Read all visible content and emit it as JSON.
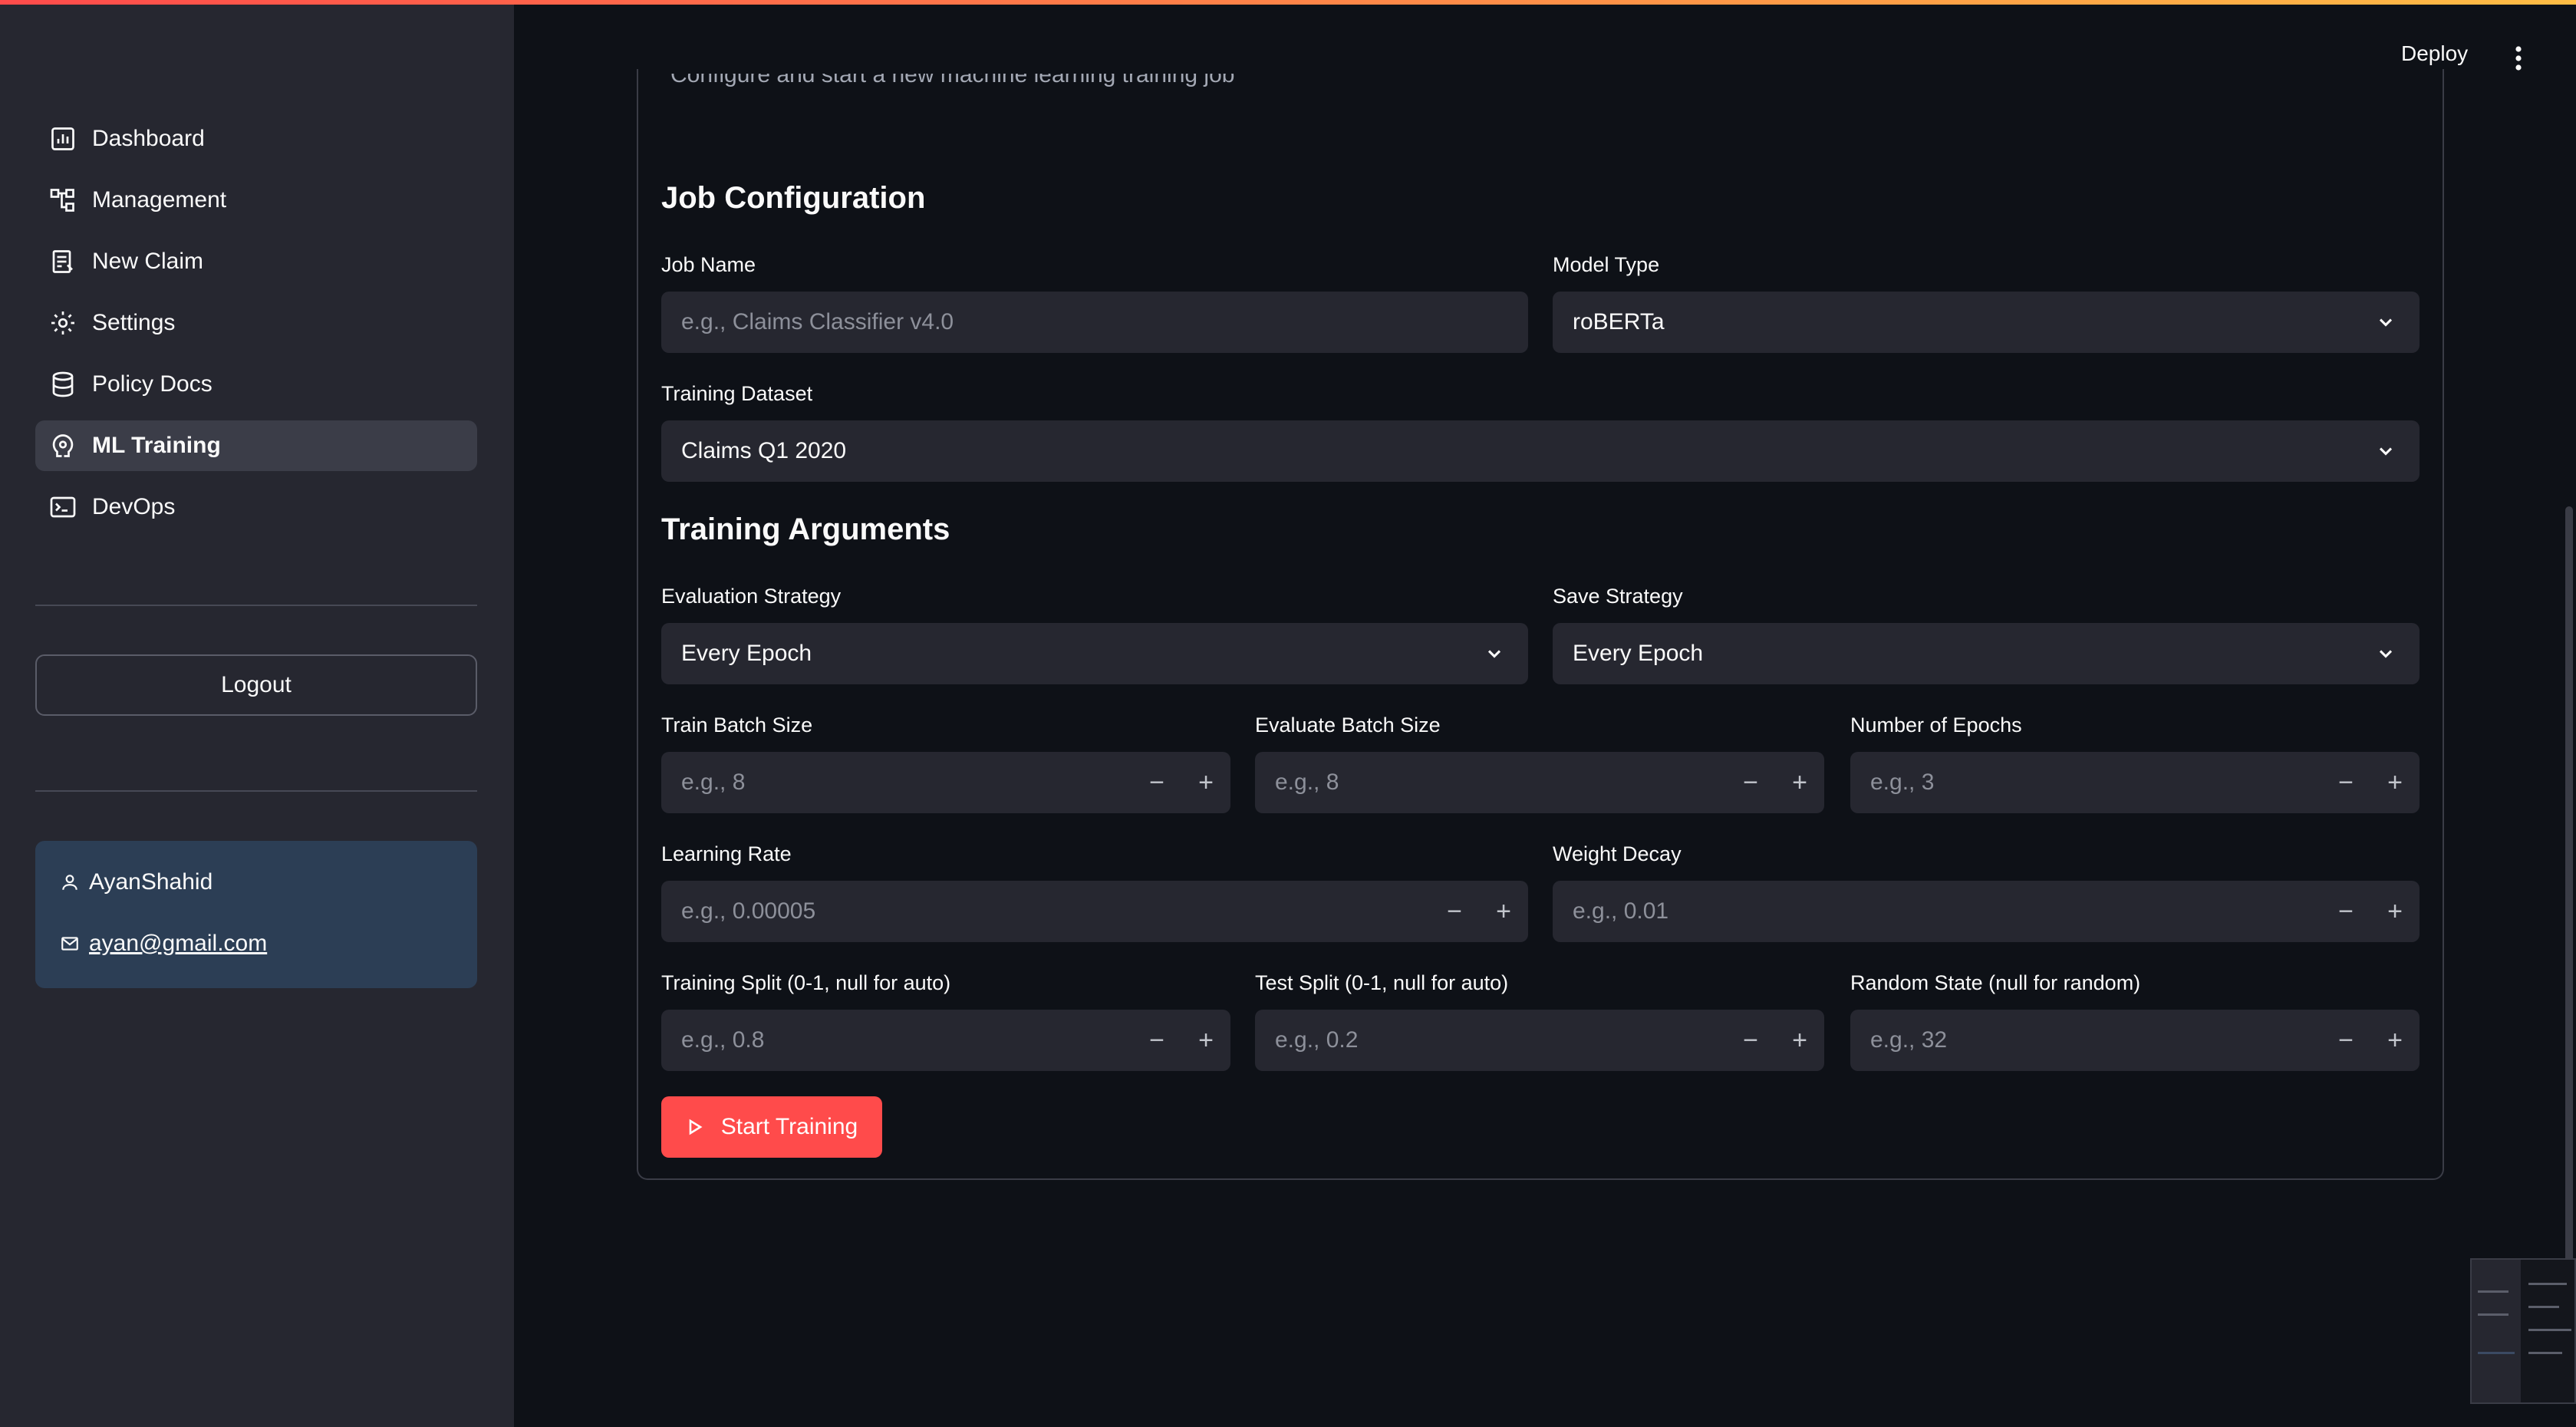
{
  "header": {
    "deploy_label": "Deploy"
  },
  "sidebar": {
    "items": [
      {
        "label": "Dashboard",
        "icon": "dashboard-icon"
      },
      {
        "label": "Management",
        "icon": "hierarchy-icon"
      },
      {
        "label": "New Claim",
        "icon": "claim-form-icon"
      },
      {
        "label": "Settings",
        "icon": "gear-icon"
      },
      {
        "label": "Policy Docs",
        "icon": "database-icon"
      },
      {
        "label": "ML Training",
        "icon": "model-training-icon",
        "active": true
      },
      {
        "label": "DevOps",
        "icon": "terminal-icon"
      }
    ],
    "logout_label": "Logout",
    "user": {
      "name": "AyanShahid",
      "email": "ayan@gmail.com"
    }
  },
  "page": {
    "subtitle": "Configure and start a new machine learning training job"
  },
  "job_config": {
    "title": "Job Configuration",
    "job_name": {
      "label": "Job Name",
      "placeholder": "e.g., Claims Classifier v4.0"
    },
    "model_type": {
      "label": "Model Type",
      "value": "roBERTa"
    },
    "training_dataset": {
      "label": "Training Dataset",
      "value": "Claims Q1 2020"
    }
  },
  "training_args": {
    "title": "Training Arguments",
    "evaluation_strategy": {
      "label": "Evaluation Strategy",
      "value": "Every Epoch"
    },
    "save_strategy": {
      "label": "Save Strategy",
      "value": "Every Epoch"
    },
    "train_batch_size": {
      "label": "Train Batch Size",
      "placeholder": "e.g., 8"
    },
    "eval_batch_size": {
      "label": "Evaluate Batch Size",
      "placeholder": "e.g., 8"
    },
    "num_epochs": {
      "label": "Number of Epochs",
      "placeholder": "e.g., 3"
    },
    "learning_rate": {
      "label": "Learning Rate",
      "placeholder": "e.g., 0.00005"
    },
    "weight_decay": {
      "label": "Weight Decay",
      "placeholder": "e.g., 0.01"
    },
    "training_split": {
      "label": "Training Split (0-1, null for auto)",
      "placeholder": "e.g., 0.8"
    },
    "test_split": {
      "label": "Test Split (0-1, null for auto)",
      "placeholder": "e.g., 0.2"
    },
    "random_state": {
      "label": "Random State (null for random)",
      "placeholder": "e.g., 32"
    },
    "stepper_minus": "−",
    "stepper_plus": "+"
  },
  "actions": {
    "start_training_label": "Start Training"
  },
  "colors": {
    "accent": "#ff4b4b",
    "sidebar_bg": "#262730",
    "main_bg": "#0e1117",
    "user_card_bg": "#2c3e55"
  }
}
